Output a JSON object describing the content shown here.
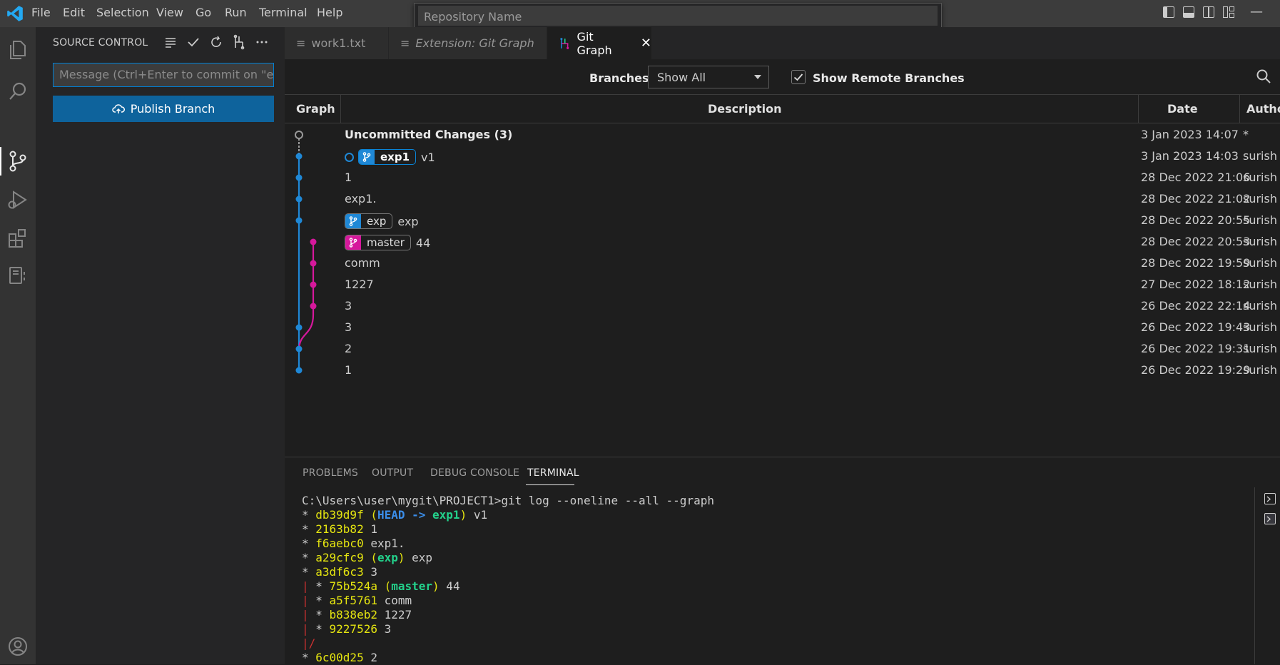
{
  "menu": [
    "File",
    "Edit",
    "Selection",
    "View",
    "Go",
    "Run",
    "Terminal",
    "Help"
  ],
  "repo_search": {
    "placeholder": "Repository Name"
  },
  "sidebar": {
    "title": "SOURCE CONTROL",
    "commit_placeholder": "Message (Ctrl+Enter to commit on \"ex...",
    "publish_label": "Publish Branch"
  },
  "tabs": [
    {
      "label": "work1.txt",
      "icon": "file-lines-icon"
    },
    {
      "label": "Extension: Git Graph",
      "icon": "file-lines-icon"
    },
    {
      "label": "Git Graph",
      "icon": "git-graph-icon"
    }
  ],
  "controls": {
    "branches_label": "Branches:",
    "branches_value": "Show All",
    "remote_label": "Show Remote Branches",
    "remote_checked": true
  },
  "table": {
    "headers": {
      "graph": "Graph",
      "description": "Description",
      "date": "Date",
      "author": "Autho"
    },
    "rows": [
      {
        "desc": "Uncommitted Changes (3)",
        "date": "3 Jan 2023 14:07",
        "author": "*"
      },
      {
        "ref": "exp1",
        "desc": "v1",
        "date": "3 Jan 2023 14:03",
        "author": "surish"
      },
      {
        "desc": "1",
        "date": "28 Dec 2022 21:06",
        "author": "surish"
      },
      {
        "desc": "exp1.",
        "date": "28 Dec 2022 21:02",
        "author": "surish"
      },
      {
        "ref": "exp",
        "desc": "exp",
        "date": "28 Dec 2022 20:55",
        "author": "surish"
      },
      {
        "ref": "master",
        "desc": "44",
        "date": "28 Dec 2022 20:53",
        "author": "surish"
      },
      {
        "desc": "comm",
        "date": "28 Dec 2022 19:59",
        "author": "surish"
      },
      {
        "desc": "1227",
        "date": "27 Dec 2022 18:12",
        "author": "surish"
      },
      {
        "desc": "3",
        "date": "26 Dec 2022 22:14",
        "author": "surish"
      },
      {
        "desc": "3",
        "date": "26 Dec 2022 19:43",
        "author": "surish"
      },
      {
        "desc": "2",
        "date": "26 Dec 2022 19:31",
        "author": "surish"
      },
      {
        "desc": "1",
        "date": "26 Dec 2022 19:29",
        "author": "surish"
      }
    ]
  },
  "colors": {
    "branch_blue": "#1f88d6",
    "branch_magenta": "#d6189c",
    "accent": "#0e639c"
  },
  "panel": {
    "tabs": [
      "PROBLEMS",
      "OUTPUT",
      "DEBUG CONSOLE",
      "TERMINAL"
    ],
    "active_tab": "TERMINAL"
  },
  "terminal": {
    "prompt": "C:\\Users\\user\\mygit\\PROJECT1>git log --oneline --all --graph",
    "l1": {
      "star": "* ",
      "hash": "db39d9f",
      "open": " (",
      "head": "HEAD -> ",
      "branch": "exp1",
      "close": ")",
      "msg": " v1"
    },
    "l2": {
      "star": "* ",
      "hash": "2163b82",
      "msg": " 1"
    },
    "l3": {
      "star": "* ",
      "hash": "f6aebc0",
      "msg": " exp1."
    },
    "l4": {
      "star": "* ",
      "hash": "a29cfc9",
      "open": " (",
      "branch": "exp",
      "close": ")",
      "msg": " exp"
    },
    "l5": {
      "star": "* ",
      "hash": "a3df6c3",
      "msg": " 3"
    },
    "l6": {
      "pipe": "| ",
      "star": "* ",
      "hash": "75b524a",
      "open": " (",
      "branch": "master",
      "close": ")",
      "msg": " 44"
    },
    "l7": {
      "pipe": "| ",
      "star": "* ",
      "hash": "a5f5761",
      "msg": " comm"
    },
    "l8": {
      "pipe": "| ",
      "star": "* ",
      "hash": "b838eb2",
      "msg": " 1227"
    },
    "l9": {
      "pipe": "| ",
      "star": "* ",
      "hash": "9227526",
      "msg": " 3"
    },
    "l10": {
      "pipe": "|/"
    },
    "l11": {
      "star": "* ",
      "hash": "6c00d25",
      "msg": " 2"
    }
  }
}
